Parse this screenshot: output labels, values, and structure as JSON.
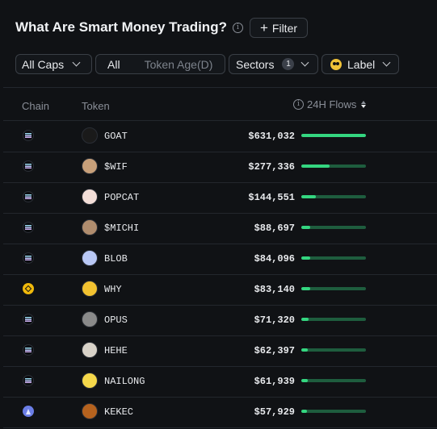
{
  "header": {
    "title": "What Are Smart Money Trading?",
    "info_icon": "i",
    "filter_label": "Filter",
    "filter_icon": "+"
  },
  "filters": {
    "caps": "All Caps",
    "age_all": "All",
    "age_label": "Token Age(D)",
    "sectors": "Sectors",
    "sectors_count": "1",
    "label": "Label"
  },
  "table": {
    "columns": {
      "chain": "Chain",
      "token": "Token",
      "flows": "24H Flows"
    },
    "rows": [
      {
        "chain": "solana",
        "token": "GOAT",
        "flow": "$631,032",
        "share": 1.0,
        "avatar_color": "#1a1a1a"
      },
      {
        "chain": "solana",
        "token": "$WIF",
        "flow": "$277,336",
        "share": 0.44,
        "avatar_color": "#c8a07a"
      },
      {
        "chain": "solana",
        "token": "POPCAT",
        "flow": "$144,551",
        "share": 0.23,
        "avatar_color": "#f3ded8"
      },
      {
        "chain": "solana",
        "token": "$MICHI",
        "flow": "$88,697",
        "share": 0.14,
        "avatar_color": "#b08d6e"
      },
      {
        "chain": "solana",
        "token": "BLOB",
        "flow": "$84,096",
        "share": 0.133,
        "avatar_color": "#b9c8f5"
      },
      {
        "chain": "bsc",
        "token": "WHY",
        "flow": "$83,140",
        "share": 0.132,
        "avatar_color": "#f2c230"
      },
      {
        "chain": "solana",
        "token": "OPUS",
        "flow": "$71,320",
        "share": 0.113,
        "avatar_color": "#8a8a8a"
      },
      {
        "chain": "solana",
        "token": "HEHE",
        "flow": "$62,397",
        "share": 0.099,
        "avatar_color": "#d8d2c8"
      },
      {
        "chain": "solana",
        "token": "NAILONG",
        "flow": "$61,939",
        "share": 0.098,
        "avatar_color": "#f5d84a"
      },
      {
        "chain": "ethereum",
        "token": "KEKEC",
        "flow": "$57,929",
        "share": 0.092,
        "avatar_color": "#b5621e"
      }
    ]
  },
  "colors": {
    "background": "#101215",
    "bar_track": "#1e5d3e",
    "bar_fill": "#34d680"
  }
}
